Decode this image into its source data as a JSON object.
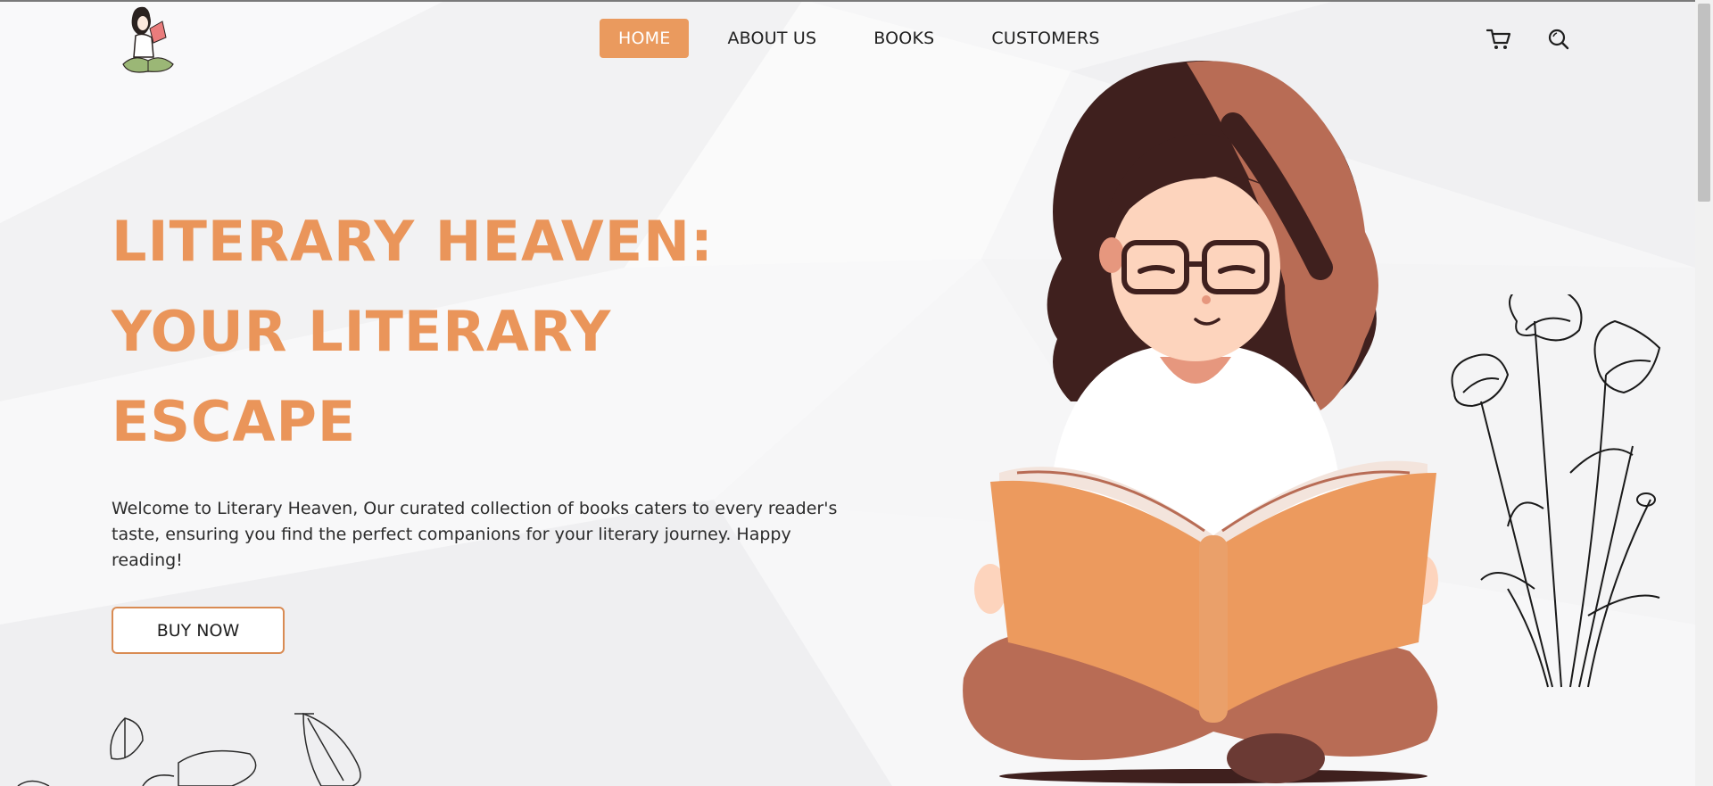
{
  "brand": {
    "logo_alt": "Literary Heaven logo"
  },
  "nav": {
    "items": [
      {
        "label": "HOME",
        "active": true
      },
      {
        "label": "ABOUT US",
        "active": false
      },
      {
        "label": "BOOKS",
        "active": false
      },
      {
        "label": "CUSTOMERS",
        "active": false
      }
    ]
  },
  "header_icons": {
    "cart": "cart-icon",
    "search": "search-icon"
  },
  "hero": {
    "title_lines": [
      "LITERARY HEAVEN:",
      "YOUR LITERARY",
      "ESCAPE"
    ],
    "description": "Welcome to Literary Heaven, Our curated collection of books caters to every reader's taste, ensuring you find the perfect companions for your literary journey. Happy reading!",
    "cta_label": "BUY NOW"
  },
  "colors": {
    "accent": "#ea9a5e",
    "title": "#ea955a",
    "book": "#ec9a5e",
    "hair_dark": "#3f201e",
    "hair_light": "#b86c55",
    "pants": "#b86c55"
  }
}
